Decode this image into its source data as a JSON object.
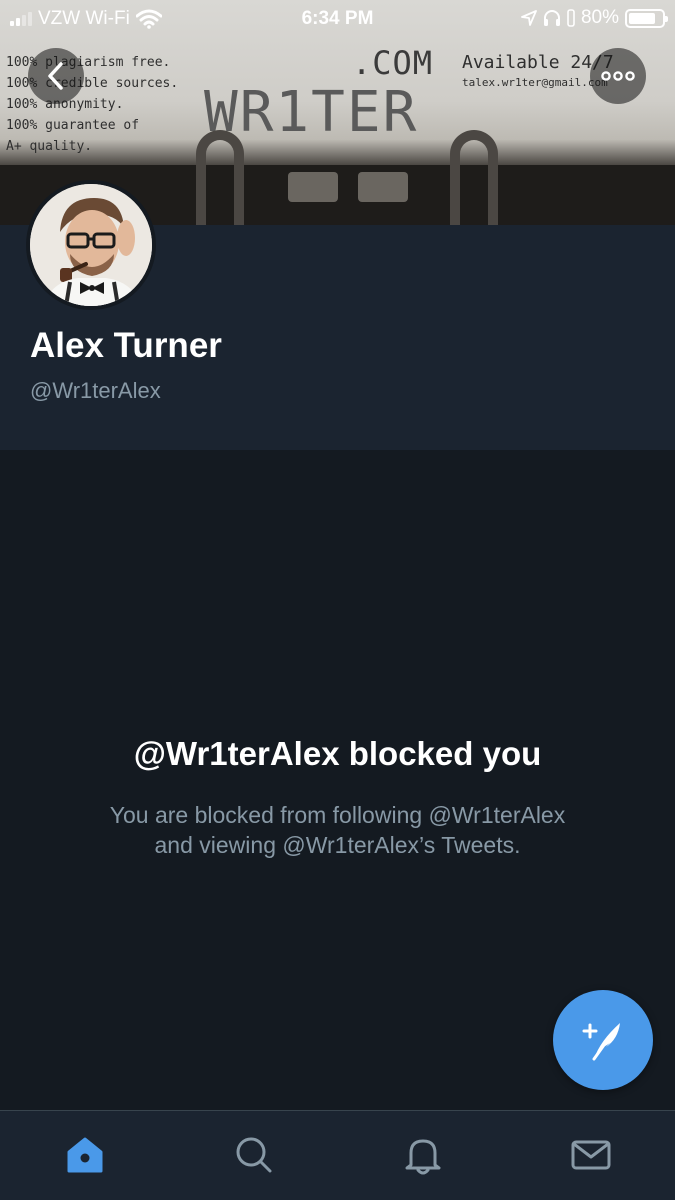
{
  "status_bar": {
    "carrier": "VZW Wi-Fi",
    "time": "6:34 PM",
    "battery_percent": "80%",
    "battery_level": 0.8,
    "icons": [
      "signal-icon",
      "wifi-icon",
      "location-arrow-icon",
      "headphones-icon",
      "battery-icon"
    ]
  },
  "banner": {
    "left_lines": [
      "100% plagiarism free.",
      "100% credible sources.",
      "100% anonymity.",
      "100% guarantee of",
      "A+ quality."
    ],
    "domain_text": ".COM",
    "brand_text": "WR1TER",
    "availability": "Available 24/7",
    "email": "talex.wr1ter@gmail.com"
  },
  "header_buttons": {
    "back_icon": "chevron-left-icon",
    "more_icon": "ellipsis-icon"
  },
  "profile": {
    "display_name": "Alex Turner",
    "handle": "@Wr1terAlex"
  },
  "blocked": {
    "title": "@Wr1terAlex blocked you",
    "line1": "You are blocked from following @Wr1terAlex",
    "line2": "and viewing @Wr1terAlex’s Tweets."
  },
  "compose_icon": "compose-tweet-icon",
  "tabs": [
    {
      "name": "home",
      "icon": "home-icon",
      "active": true
    },
    {
      "name": "search",
      "icon": "search-icon",
      "active": false
    },
    {
      "name": "notifications",
      "icon": "bell-icon",
      "active": false
    },
    {
      "name": "messages",
      "icon": "mail-icon",
      "active": false
    }
  ],
  "colors": {
    "background": "#141a21",
    "profile_bg": "#1b2430",
    "accent": "#4a99e9",
    "secondary_text": "#8899a6"
  }
}
